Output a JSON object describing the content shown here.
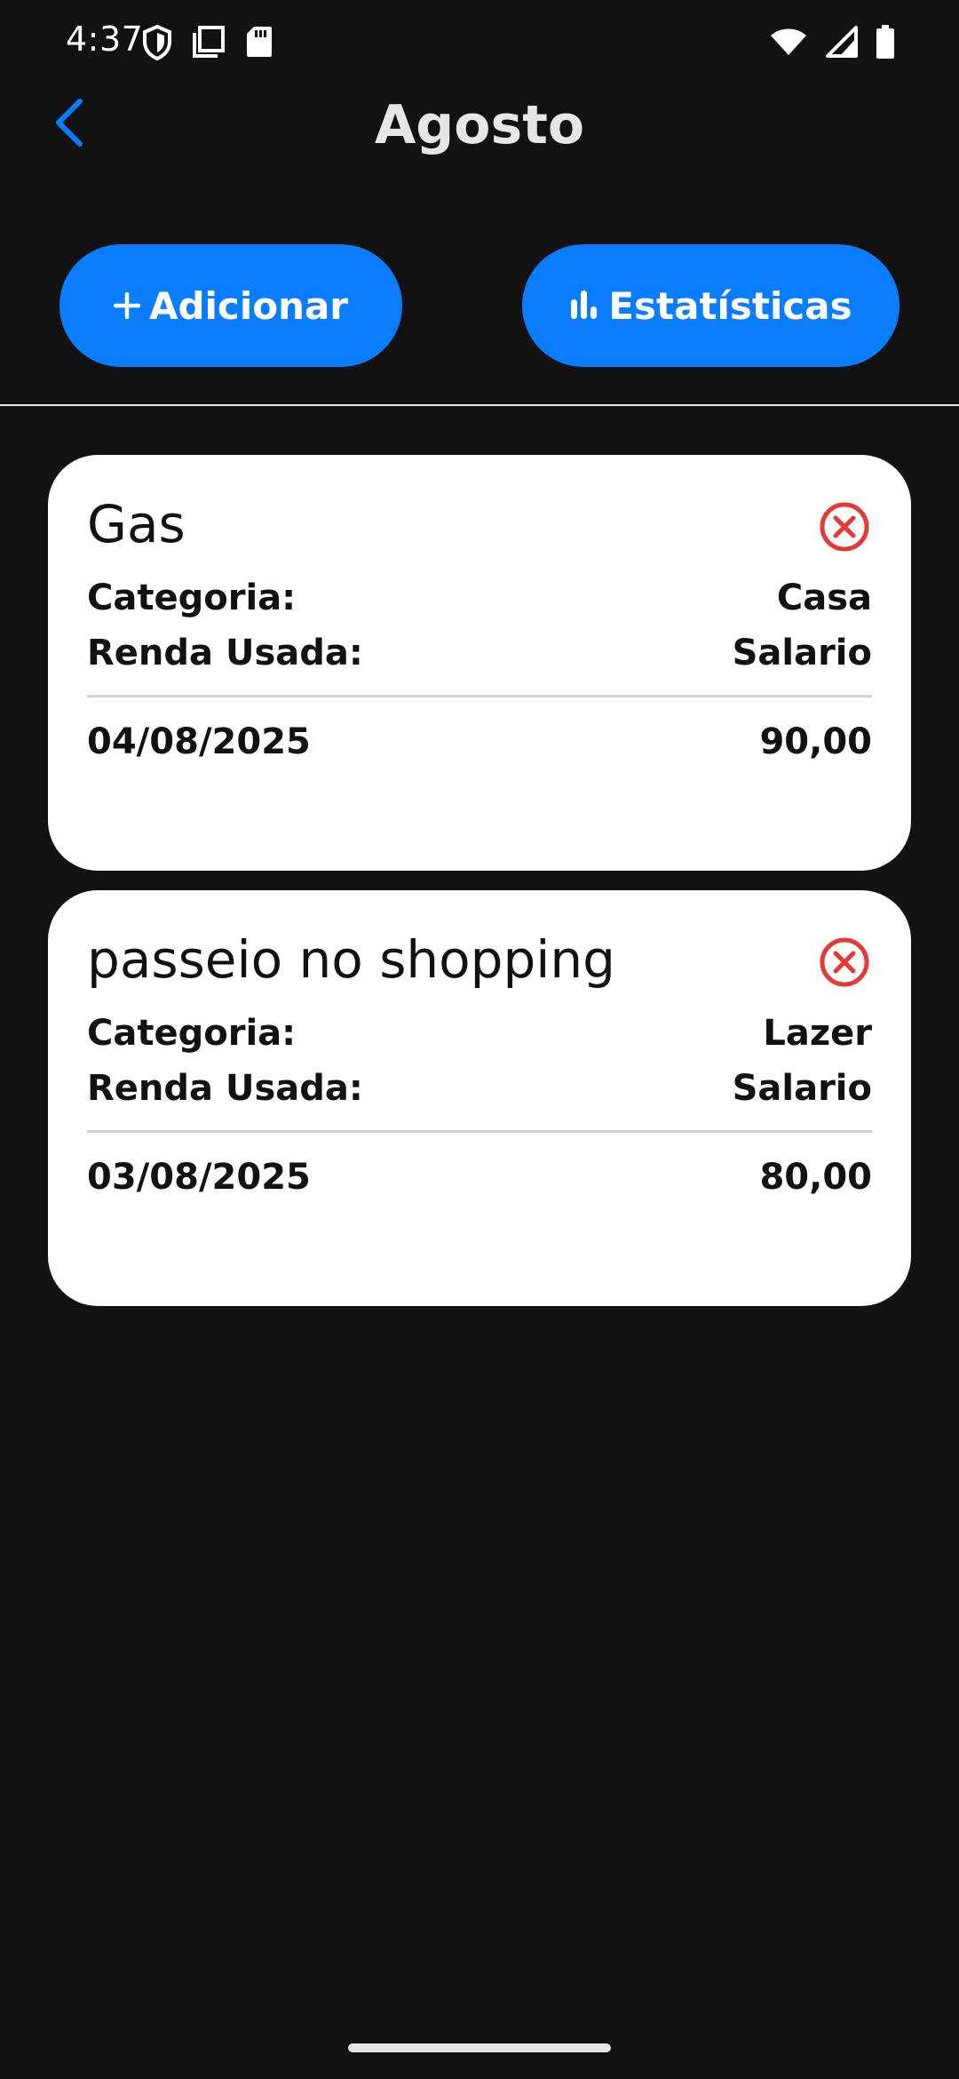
{
  "status_bar": {
    "time": "4:37",
    "icons_left": [
      "shield-icon",
      "copy-icon",
      "sd-card-icon"
    ],
    "icons_right": [
      "wifi-icon",
      "signal-icon",
      "battery-icon"
    ]
  },
  "header": {
    "title": "Agosto",
    "back_icon": "chevron-left-icon"
  },
  "actions": {
    "add_label": "Adicionar",
    "add_icon": "plus-icon",
    "stats_label": "Estatísticas",
    "stats_icon": "bar-chart-icon"
  },
  "labels": {
    "category": "Categoria:",
    "income_used": "Renda Usada:"
  },
  "expenses": [
    {
      "title": "Gas",
      "category": "Casa",
      "income": "Salario",
      "date": "04/08/2025",
      "amount": "90,00"
    },
    {
      "title": "passeio no shopping",
      "category": "Lazer",
      "income": "Salario",
      "date": "03/08/2025",
      "amount": "80,00"
    }
  ],
  "colors": {
    "background": "#121212",
    "accent": "#0a7cff",
    "delete": "#e53935",
    "card": "#ffffff"
  }
}
